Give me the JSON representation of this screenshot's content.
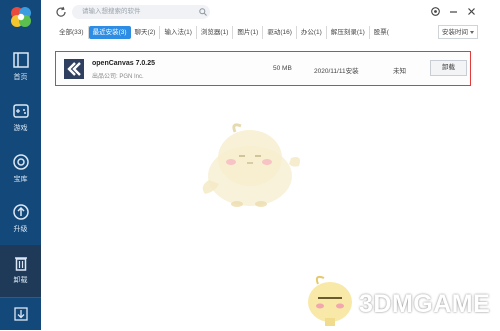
{
  "sidebar": {
    "items": [
      {
        "label": "首页",
        "icon": "home-icon"
      },
      {
        "label": "游戏",
        "icon": "gamepad-icon"
      },
      {
        "label": "宝库",
        "icon": "treasure-icon"
      },
      {
        "label": "升级",
        "icon": "upgrade-icon"
      },
      {
        "label": "卸载",
        "icon": "trash-icon"
      }
    ],
    "active_index": 4
  },
  "search": {
    "placeholder": "请输入想搜索的软件"
  },
  "tabs": [
    {
      "label": "全部(33)"
    },
    {
      "label": "最近安装(3)"
    },
    {
      "label": "聊天(2)"
    },
    {
      "label": "输入法(1)"
    },
    {
      "label": "浏览器(1)"
    },
    {
      "label": "图片(1)"
    },
    {
      "label": "驱动(16)"
    },
    {
      "label": "办公(1)"
    },
    {
      "label": "解压刻录(1)"
    },
    {
      "label": "股票("
    }
  ],
  "active_tab_index": 1,
  "sort": {
    "label": "安装时间"
  },
  "app": {
    "name": "openCanvas 7.0.25",
    "publisher": "出品公司: PGN Inc.",
    "size": "50 MB",
    "date": "2020/11/11安装",
    "status": "未知",
    "uninstall_label": "卸载"
  },
  "watermark": {
    "text": "3DMGAME"
  },
  "colors": {
    "sidebar_bg": "#13487a",
    "sidebar_active": "#1e3a58",
    "accent": "#2d8ce3",
    "highlight_border": "#e23b3b"
  }
}
